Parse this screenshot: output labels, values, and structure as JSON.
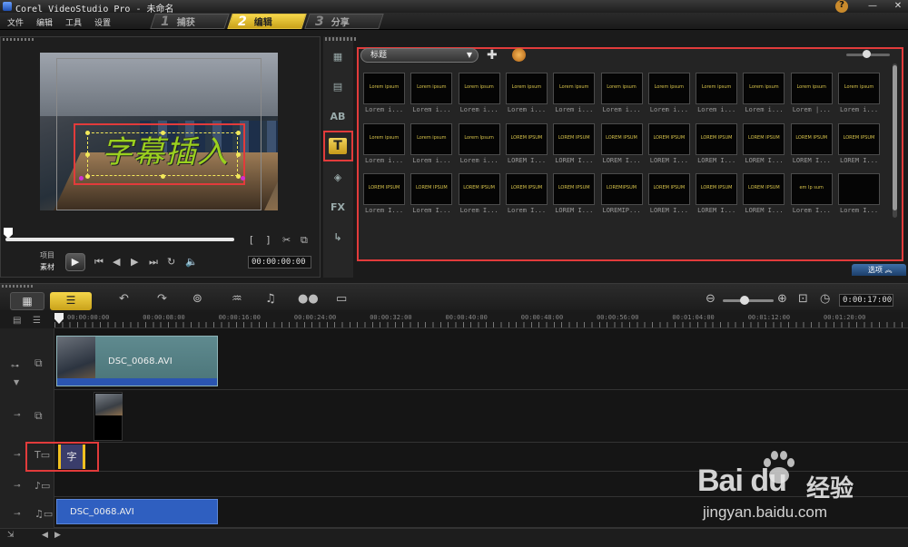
{
  "window": {
    "title": "Corel VideoStudio Pro - 未命名",
    "help_label": "?",
    "minimize_label": "—",
    "close_label": "✕"
  },
  "menu": [
    "文件",
    "编辑",
    "工具",
    "设置"
  ],
  "steps": [
    {
      "num": "1",
      "label": "捕获"
    },
    {
      "num": "2",
      "label": "编辑"
    },
    {
      "num": "3",
      "label": "分享"
    }
  ],
  "preview": {
    "caption_text": "字幕插入",
    "mode_project": "项目",
    "mode_clip": "素材",
    "timecode": "00:00:00:00"
  },
  "library": {
    "category": "标题",
    "thumbnails": [
      {
        "sample": "Lorem ipsum",
        "label": "Lorem i..."
      },
      {
        "sample": "Lorem ipsum",
        "label": "Lorem i..."
      },
      {
        "sample": "Lorem ipsum",
        "label": "Lorem i..."
      },
      {
        "sample": "Lorem ipsum",
        "label": "Lorem i..."
      },
      {
        "sample": "Lorem ipsum",
        "label": "Lorem i..."
      },
      {
        "sample": "Lorem ipsum",
        "label": "Lorem i..."
      },
      {
        "sample": "Lorem ipsum",
        "label": "Lorem i..."
      },
      {
        "sample": "Lorem ipsum",
        "label": "Lorem i..."
      },
      {
        "sample": "Lorem ipsum",
        "label": "Lorem i..."
      },
      {
        "sample": "Lorem ipsum",
        "label": "Lorem |..."
      },
      {
        "sample": "Lorem ipsum",
        "label": "Lorem i..."
      },
      {
        "sample": "Lorem ipsum",
        "label": "Lorem i..."
      },
      {
        "sample": "Lorem ipsum",
        "label": "Lorem i..."
      },
      {
        "sample": "Lorem Ipsum",
        "label": "Lorem i..."
      },
      {
        "sample": "LOREM IPSUM",
        "label": "LOREM I..."
      },
      {
        "sample": "LOREM IPSUM",
        "label": "LOREM I..."
      },
      {
        "sample": "LOREM IPSUM",
        "label": "LOREM I..."
      },
      {
        "sample": "LOREM IPSUM",
        "label": "LOREM I..."
      },
      {
        "sample": "LOREM IPSUM",
        "label": "LOREM I..."
      },
      {
        "sample": "LOREM IPSUM",
        "label": "LOREM I..."
      },
      {
        "sample": "LOREM IPSUM",
        "label": "LOREM I..."
      },
      {
        "sample": "LOREM IPSUM",
        "label": "LOREM I..."
      },
      {
        "sample": "LOREM IPSUM",
        "label": "Lorem I..."
      },
      {
        "sample": "LOREM IPSUM",
        "label": "Lorem I..."
      },
      {
        "sample": "LOREM IPSUM",
        "label": "Lorem I..."
      },
      {
        "sample": "LOREM IPSUM",
        "label": "Lorem I..."
      },
      {
        "sample": "LOREM IPSUM",
        "label": "LOREM I..."
      },
      {
        "sample": "LOREMIPSUM",
        "label": "LOREMIP..."
      },
      {
        "sample": "LOREM IPSUM",
        "label": "LOREM I..."
      },
      {
        "sample": "LOREM IPSUM",
        "label": "LOREM I..."
      },
      {
        "sample": "LOREM IPSUM",
        "label": "LOREM I..."
      },
      {
        "sample": "em Ip sum",
        "label": "Lorem I..."
      },
      {
        "sample": "",
        "label": "Lorem I..."
      }
    ],
    "options_label": "选项"
  },
  "timeline": {
    "duration": "0:00:17:00",
    "ruler": [
      "00:00:00:00",
      "00:00:08:00",
      "00:00:16:00",
      "00:00:24:00",
      "00:00:32:00",
      "00:00:40:00",
      "00:00:48:00",
      "00:00:56:00",
      "00:01:04:00",
      "00:01:12:00",
      "00:01:20:00"
    ],
    "video_clip": "DSC_0068.AVI",
    "title_clip": "字",
    "music_clip": "DSC_0068.AVI"
  },
  "watermark": {
    "brand": "Bai du",
    "jingyan": "经验",
    "url": "jingyan.baidu.com"
  },
  "colors": {
    "accent_yellow": "#f5d64a",
    "highlight_red": "#e23b3b",
    "caption_green": "#9ad01f",
    "clip_teal": "#5f8a8f",
    "clip_blue": "#2f5fc0"
  }
}
